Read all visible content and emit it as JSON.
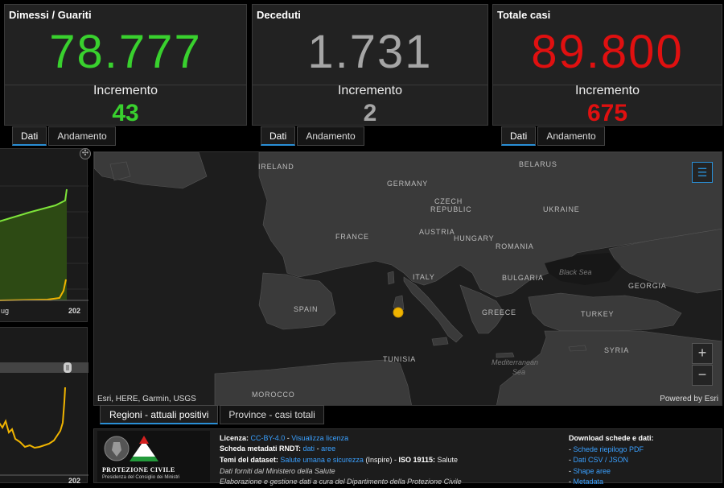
{
  "cards": [
    {
      "title": "Dimessi / Guariti",
      "value": "78.777",
      "inc_label": "Incremento",
      "inc_value": "43",
      "color": "#39d12e"
    },
    {
      "title": "Deceduti",
      "value": "1.731",
      "inc_label": "Incremento",
      "inc_value": "2",
      "color": "#a6a6a6"
    },
    {
      "title": "Totale casi",
      "value": "89.800",
      "inc_label": "Incremento",
      "inc_value": "675",
      "color": "#e01010"
    }
  ],
  "card_tabs": {
    "dati": "Dati",
    "andamento": "Andamento"
  },
  "left_chart": {
    "x_start": "ug",
    "x_end": "202"
  },
  "left_chart2": {
    "x_end": "202"
  },
  "map": {
    "countries": {
      "ireland": "IRELAND",
      "belarus": "BELARUS",
      "germany": "GERMANY",
      "czech1": "CZECH",
      "czech2": "REPUBLIC",
      "ukraine": "UKRAINE",
      "france": "FRANCE",
      "austria": "AUSTRIA",
      "hungary": "HUNGARY",
      "romania": "ROMANIA",
      "italy": "ITALY",
      "bulgaria": "BULGARIA",
      "georgia": "GEORGIA",
      "spain": "SPAIN",
      "greece": "GREECE",
      "turkey": "TURKEY",
      "tunisia": "TUNISIA",
      "syria": "SYRIA",
      "morocco": "MOROCCO"
    },
    "seas": {
      "black_sea": "Black Sea",
      "med1": "Mediterranean",
      "med2": "Sea"
    },
    "attribution": "Esri, HERE, Garmin, USGS",
    "powered": "Powered by Esri",
    "zoom_in": "+",
    "zoom_out": "−",
    "marker_color": "#f0b400"
  },
  "bottom_tabs": {
    "regioni": "Regioni - attuali positivi",
    "province": "Province - casi totali"
  },
  "info": {
    "logo_title": "PROTEZIONE CIVILE",
    "logo_sub": "Presidenza del Consiglio dei Ministri",
    "licenza_label": "Licenza:",
    "licenza_link1": "CC-BY-4.0",
    "licenza_sep": " - ",
    "licenza_link2": "Visualizza licenza",
    "scheda_label": "Scheda metadati RNDT:",
    "scheda_link1": "dati",
    "scheda_sep": " - ",
    "scheda_link2": "aree",
    "temi_label": "Temi del dataset:",
    "temi_link": "Salute umana e sicurezza",
    "temi_rest": "(Inspire) -",
    "iso_label": "ISO 19115:",
    "iso_value": "Salute",
    "dati_forniti": "Dati forniti dal Ministero della Salute",
    "elaborazione": "Elaborazione e gestione dati a cura del Dipartimento della Protezione Civile",
    "download_title": "Download schede e dati:",
    "download_links": [
      "Schede riepilogo PDF",
      "Dati CSV / JSON",
      "Shape aree",
      "Metadata"
    ]
  }
}
